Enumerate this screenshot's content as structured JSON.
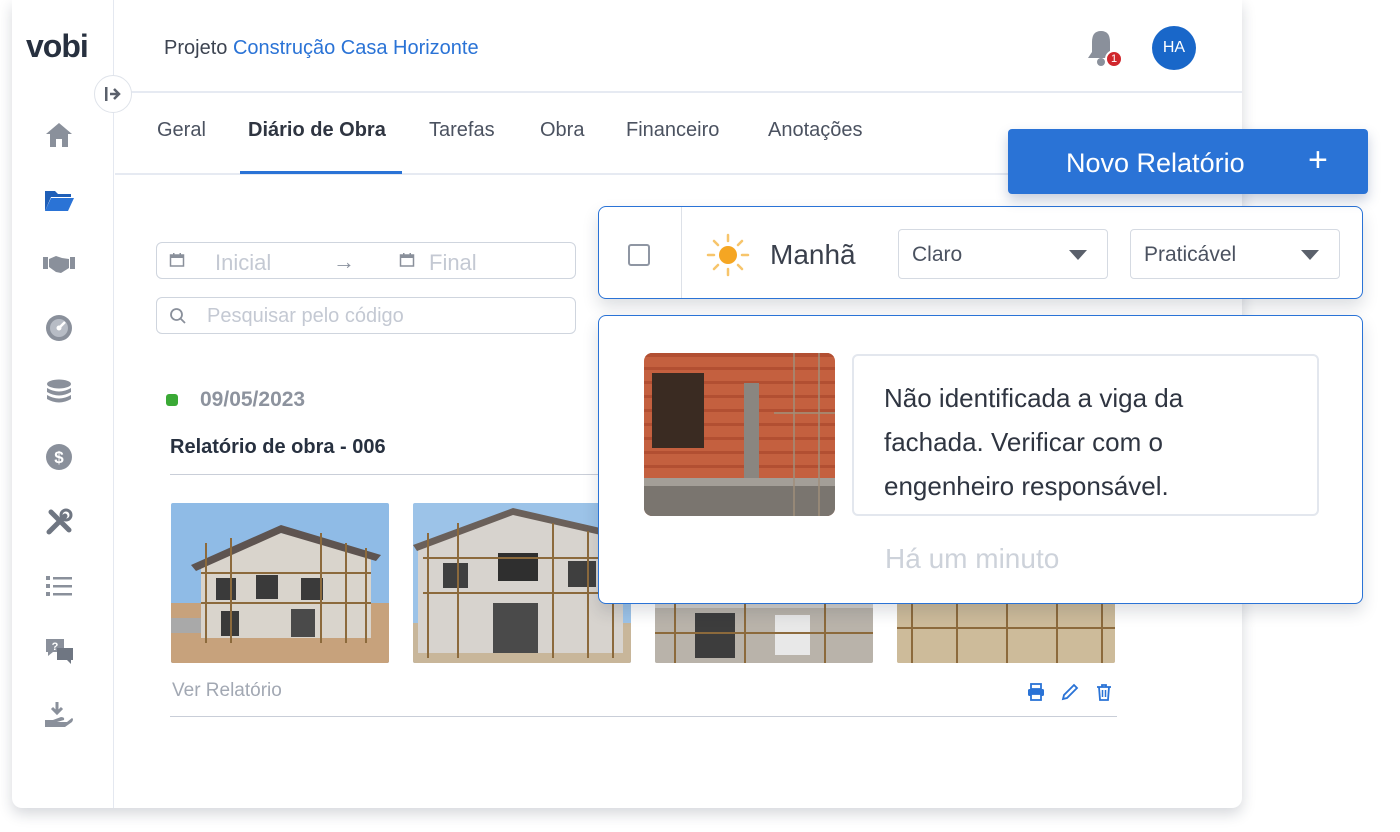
{
  "brand": {
    "logo": "vobi",
    "accent": "#2a73d6"
  },
  "header": {
    "project_prefix": "Projeto",
    "project_name": "Construção Casa Horizonte",
    "notification_count": "1",
    "avatar_initials": "HA"
  },
  "sidebar": {
    "items": [
      {
        "icon": "home-icon"
      },
      {
        "icon": "folder-icon",
        "active": true
      },
      {
        "icon": "handshake-icon"
      },
      {
        "icon": "dashboard-gauge-icon"
      },
      {
        "icon": "coins-icon"
      },
      {
        "icon": "dollar-icon"
      },
      {
        "icon": "tools-icon"
      },
      {
        "icon": "list-icon"
      },
      {
        "icon": "help-chat-icon"
      },
      {
        "icon": "hand-money-icon"
      }
    ]
  },
  "tabs": [
    {
      "label": "Geral"
    },
    {
      "label": "Diário de Obra",
      "active": true
    },
    {
      "label": "Tarefas"
    },
    {
      "label": "Obra"
    },
    {
      "label": "Financeiro"
    },
    {
      "label": "Anotações"
    }
  ],
  "filters": {
    "date_start_placeholder": "Inicial",
    "date_arrow": "→",
    "date_end_placeholder": "Final",
    "search_placeholder": "Pesquisar pelo código"
  },
  "report": {
    "date": "09/05/2023",
    "title": "Relatório de obra - 006",
    "view_link": "Ver Relatório"
  },
  "new_report_button": {
    "label": "Novo Relatório",
    "icon": "+"
  },
  "weather": {
    "period": "Manhã",
    "condition": "Claro",
    "status": "Praticável"
  },
  "note": {
    "text": "Não identificada a viga da fachada. Verificar com o engenheiro responsável.",
    "time": "Há um minuto"
  }
}
